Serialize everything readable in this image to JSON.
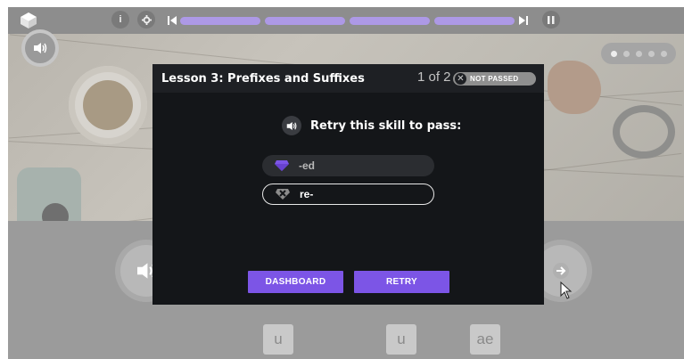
{
  "topbar": {
    "info_label": "i",
    "settings_icon": "gear-icon",
    "pause_icon": "pause-icon",
    "progress_segments": [
      1,
      1,
      1,
      1
    ],
    "accent": "#ad99e6"
  },
  "stage": {
    "carousel": {
      "total": 5,
      "active": 0
    }
  },
  "modal": {
    "title": "Lesson 3:  Prefixes and Suffixes",
    "page_count": "1 of 2",
    "badge": "NOT PASSED",
    "prompt": "Retry this skill to pass:",
    "skills": [
      {
        "label": "-ed",
        "status": "passed",
        "color": "#7c55e6"
      },
      {
        "label": "re-",
        "status": "failed",
        "color": "#8c8c8c"
      }
    ],
    "dashboard_label": "DASHBOARD",
    "retry_label": "RETRY",
    "button_color": "#7c55e6"
  },
  "tiles": [
    "u",
    "u",
    "ae"
  ]
}
